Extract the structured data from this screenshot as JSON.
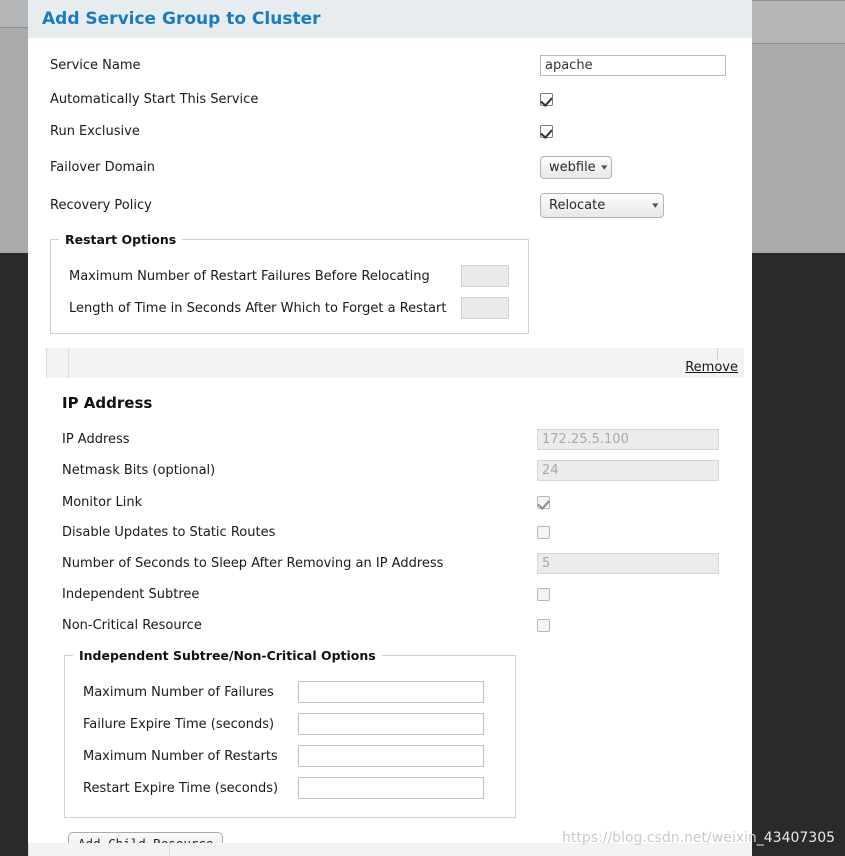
{
  "dialog": {
    "title": "Add Service Group to Cluster"
  },
  "form": {
    "service_name": {
      "label": "Service Name",
      "value": "apache",
      "placeholder": ""
    },
    "auto_start": {
      "label": "Automatically Start This Service",
      "checked": true
    },
    "run_exclusive": {
      "label": "Run Exclusive",
      "checked": true
    },
    "failover_domain": {
      "label": "Failover Domain",
      "selected": "webfile"
    },
    "recovery_policy": {
      "label": "Recovery Policy",
      "selected": "Relocate"
    }
  },
  "restart_options": {
    "legend": "Restart Options",
    "max_restart_failures": {
      "label": "Maximum Number of Restart Failures Before Relocating",
      "value": ""
    },
    "forget_restart_seconds": {
      "label": "Length of Time in Seconds After Which to Forget a Restart",
      "value": ""
    }
  },
  "resource": {
    "remove_label": "Remove",
    "section_title": "IP Address",
    "fields": {
      "ip_address": {
        "label": "IP Address",
        "value": "172.25.5.100"
      },
      "netmask_bits": {
        "label": "Netmask Bits (optional)",
        "value": "24"
      },
      "monitor_link": {
        "label": "Monitor Link",
        "checked": true
      },
      "disable_static_routes": {
        "label": "Disable Updates to Static Routes",
        "checked": false
      },
      "sleep_seconds": {
        "label": "Number of Seconds to Sleep After Removing an IP Address",
        "value": "5"
      },
      "independent_subtree": {
        "label": "Independent Subtree",
        "checked": false
      },
      "non_critical_resource": {
        "label": "Non-Critical Resource",
        "checked": false
      }
    }
  },
  "subtree_options": {
    "legend": "Independent Subtree/Non-Critical Options",
    "max_failures": {
      "label": "Maximum Number of Failures",
      "value": ""
    },
    "failure_expire": {
      "label": "Failure Expire Time (seconds)",
      "value": ""
    },
    "max_restarts": {
      "label": "Maximum Number of Restarts",
      "value": ""
    },
    "restart_expire": {
      "label": "Restart Expire Time (seconds)",
      "value": ""
    }
  },
  "actions": {
    "add_child_resource": "Add Child Resource"
  },
  "watermark": {
    "dim_text": "https://blog.csdn.net/weixin",
    "bright_text": "_43407305"
  },
  "colors": {
    "accent_blue": "#1a7cc0",
    "header_bg": "#e7ecef",
    "backdrop_gray": "#a9aaac",
    "backdrop_dark": "#282a2c"
  }
}
